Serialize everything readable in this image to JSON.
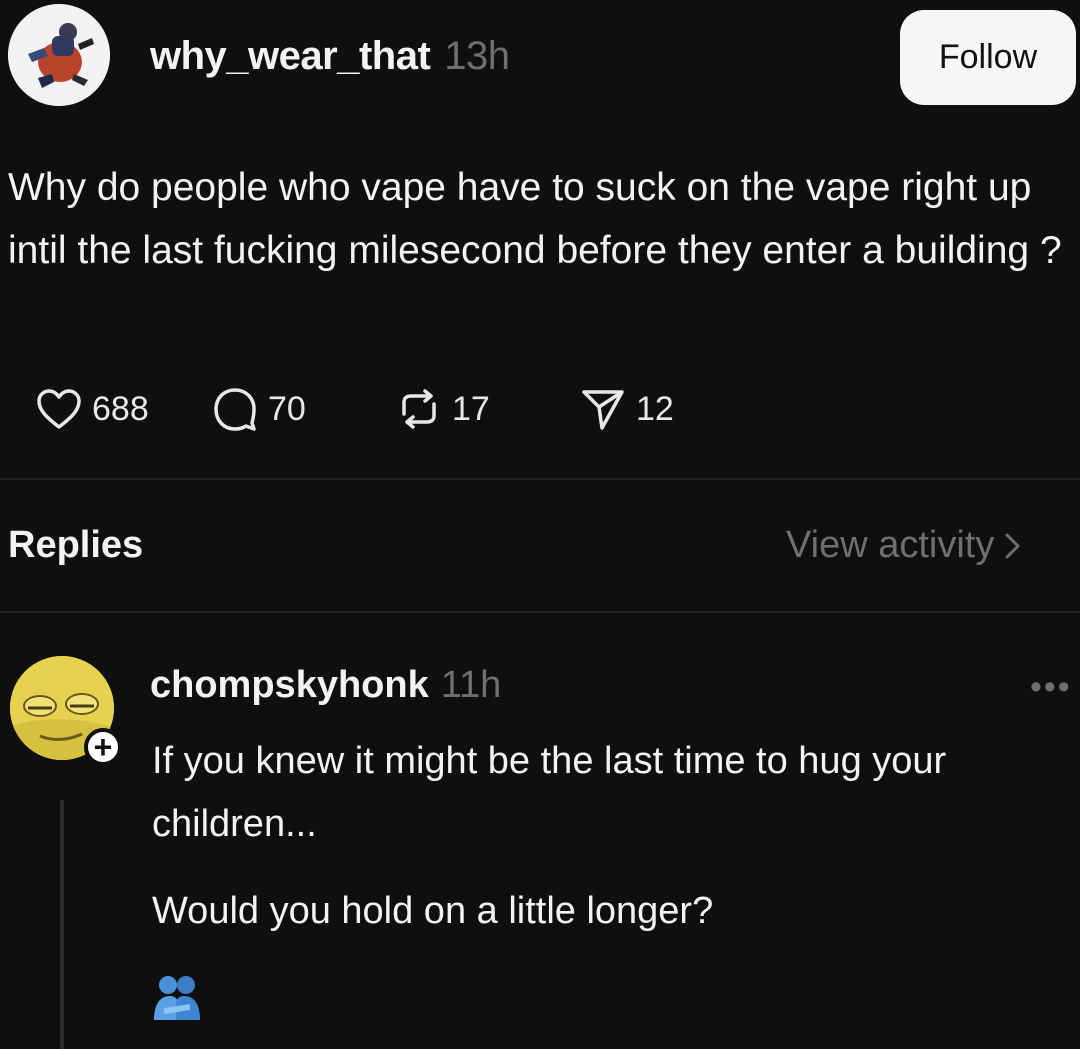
{
  "post": {
    "username": "why_wear_that",
    "time": "13h",
    "follow_label": "Follow",
    "text": "Why do people who vape have to suck on the vape right up intil the last fucking milesecond before they enter a building ?",
    "stats": {
      "likes": "688",
      "replies": "70",
      "reposts": "17",
      "shares": "12"
    }
  },
  "replies_section": {
    "title": "Replies",
    "view_activity": "View activity"
  },
  "reply": {
    "username": "chompskyhonk",
    "time": "11h",
    "more": "•••",
    "plus": "+",
    "line1": "If you knew it might be the last time to hug your children...",
    "line2": "Would you hold on a little longer?",
    "emoji_icon": "people-hugging-icon"
  },
  "colors": {
    "background": "#0f0f10",
    "muted": "#6f6f73",
    "follow_bg": "#f6f6f6"
  }
}
